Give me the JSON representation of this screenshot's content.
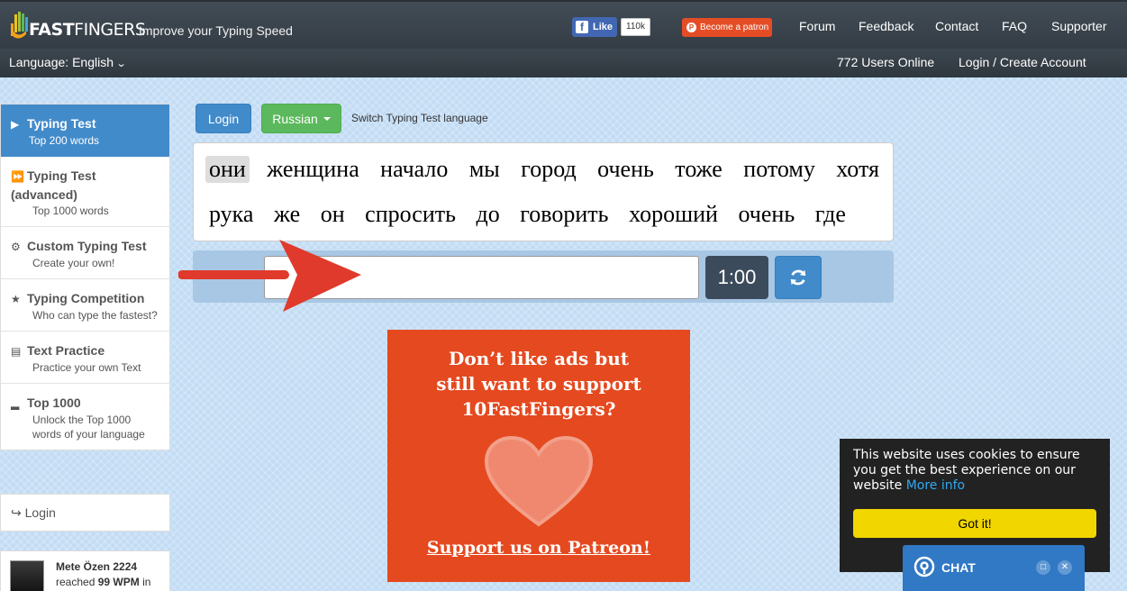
{
  "header": {
    "logo_prefix": "10",
    "logo_main": "FAST",
    "logo_suffix": "FINGERS",
    "tagline": "Improve your Typing Speed",
    "fb_like": "Like",
    "fb_count": "110k",
    "patron": "Become a patron",
    "nav": [
      "Forum",
      "Feedback",
      "Contact",
      "FAQ",
      "Supporter"
    ]
  },
  "subbar": {
    "language": "Language: English",
    "users_online": "772 Users Online",
    "login_create": "Login / Create Account"
  },
  "sidebar": {
    "items": [
      {
        "title": "Typing Test",
        "sub": "Top 200 words",
        "icon": "play-icon"
      },
      {
        "title": "Typing Test (advanced)",
        "sub": "Top 1000 words",
        "icon": "fast-forward-icon"
      },
      {
        "title": "Custom Typing Test",
        "sub": "Create your own!",
        "icon": "cogs-icon"
      },
      {
        "title": "Typing Competition",
        "sub": "Who can type the fastest?",
        "icon": "trophy-icon"
      },
      {
        "title": "Text Practice",
        "sub": "Practice your own Text",
        "icon": "document-icon"
      },
      {
        "title": "Top 1000",
        "sub": "Unlock the Top 1000 words of your language",
        "icon": "signal-icon"
      }
    ],
    "login": "Login",
    "user": {
      "name": "Mete Özen 2224",
      "wpm_prefix": "reached",
      "wpm_value": "99 WPM",
      "wpm_suffix": "in"
    }
  },
  "controls": {
    "login": "Login",
    "language": "Russian",
    "switch_label": "Switch Typing Test language",
    "timer": "1:00"
  },
  "words": {
    "line1": [
      "они",
      "женщина",
      "начало",
      "мы",
      "город",
      "очень",
      "тоже",
      "потому",
      "хотя"
    ],
    "line2": [
      "рука",
      "же",
      "он",
      "спросить",
      "до",
      "говорить",
      "хороший",
      "очень",
      "где"
    ]
  },
  "ad": {
    "line1": "Don’t like ads but",
    "line2": "still want to support",
    "line3": "10FastFingers?",
    "cta": "Support us on Patreon!"
  },
  "cookie": {
    "message": "This website uses cookies to ensure you get the best experience on our website",
    "more_info": "More info",
    "button": "Got it!"
  },
  "chat": {
    "label": "CHAT"
  }
}
